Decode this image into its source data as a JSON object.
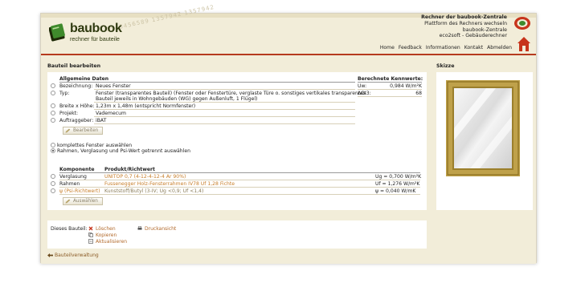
{
  "header": {
    "numbers": "1543456589 1357942 1357942",
    "logo_text": "baubook",
    "logo_sub": "rechner für bauteile",
    "tagline_title": "Rechner der baubook-Zentrale",
    "tagline_line2": "Plattform des Rechners wechseln",
    "tagline_line3": "baubook-Zentrale",
    "tagline_line4": "eco2soft - Gebäuderechner"
  },
  "nav": [
    "Home",
    "Feedback",
    "Informationen",
    "Kontakt",
    "Abmelden"
  ],
  "main": {
    "title": "Bauteil bearbeiten",
    "general": {
      "heading": "Allgemeine Daten",
      "fields": [
        {
          "label": "Bezeichnung:",
          "value": "Neues Fenster"
        },
        {
          "label": "Typ:",
          "value": "Fenster (transparentes Bauteil) (Fenster oder Fenstertüre, verglaste Türe o. sonstiges vertikales transparentes",
          "value2": "Bauteil jeweils in Wohngebäuden (WG) gegen Außenluft, 1 Flügel)"
        },
        {
          "label": "Breite x Höhe:",
          "value": "1,23m x 1,48m (entspricht Normfenster)"
        },
        {
          "label": "Projekt:",
          "value": "Vademecum"
        },
        {
          "label": "Auftraggeber:",
          "value": "iBAT"
        }
      ],
      "edit_button": "Bearbeiten"
    },
    "kennwerte": {
      "heading": "Berechnete Kennwerte:",
      "rows": [
        {
          "label": "Uw:",
          "value": "0,984 W/m²K"
        },
        {
          "label": "ΔOI3:",
          "value": "68"
        }
      ]
    },
    "options": [
      {
        "label": "komplettes Fenster auswählen",
        "selected": false
      },
      {
        "label": "Rahmen, Verglasung und Psi-Wert getrennt auswählen",
        "selected": true
      }
    ],
    "components": {
      "heading_component": "Komponente",
      "heading_product": "Produkt/Richtwert",
      "rows": [
        {
          "component": "Verglasung",
          "product": "UNITOP 0,7 (4-12-4-12-4 Ar 90%)",
          "value": "Ug = 0,700 W/m²K"
        },
        {
          "component": "Rahmen",
          "product": "Fussenegger Holz-Fensterrahmen IV78 Uf 1,28 Fichte",
          "value": "Uf = 1,276 W/m²K"
        },
        {
          "component": "ψ (Psi-Richtwert)",
          "product": "Kunststoff/Butyl (3-IV; Ug <0,9; Uf <1,4)",
          "value": "ψ = 0,040 W/mK"
        }
      ],
      "select_button": "Auswählen"
    },
    "actions": {
      "label": "Dieses Bauteil:",
      "delete": "Löschen",
      "print": "Druckansicht",
      "copy": "Kopieren",
      "refresh": "Aktualisieren"
    },
    "back_link": "Bauteilverwaltung"
  },
  "sketch": {
    "title": "Skizze"
  },
  "colors": {
    "accent_red": "#b53a1e",
    "beige": "#f2edd9",
    "link_orange": "#c77e2a",
    "frame_gold": "#bfa14a"
  }
}
